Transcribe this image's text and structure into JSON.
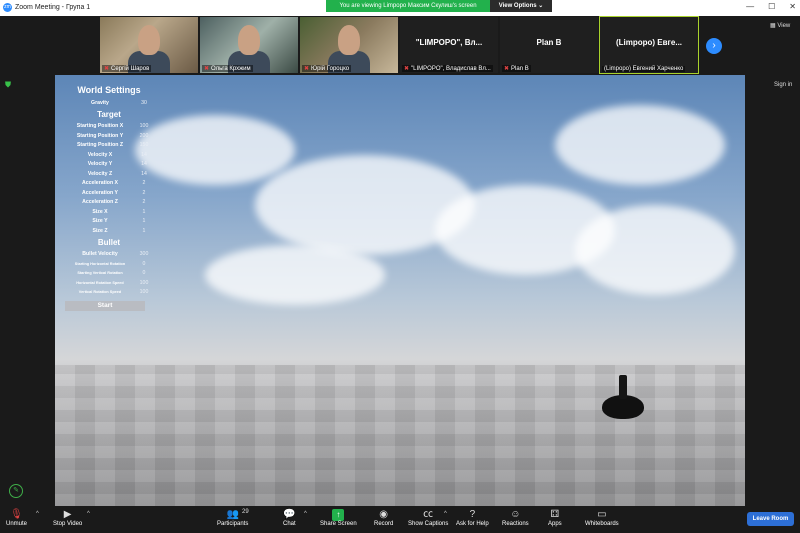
{
  "window": {
    "title": "Zoom Meeting - Група 1",
    "share_banner": "You are viewing Limpopo Максим Скулиш's screen",
    "view_options": "View Options"
  },
  "participants": [
    {
      "name": "Сергій Шаров"
    },
    {
      "name": "Ольга Крхжим"
    },
    {
      "name": "Юрій Гороцко"
    },
    {
      "name": "\"LIMPOPO\", Владислав Вл...",
      "display": "\"LIMPOPO\", Вл..."
    },
    {
      "name": "Plan B",
      "display": "Plan B"
    },
    {
      "name": "(Limpopo) Евгений Харченко",
      "display": "(Limpopo) Евге..."
    }
  ],
  "strip": {
    "view_label": "View"
  },
  "side": {
    "sign_in": "Sign in"
  },
  "settings": {
    "world_heading": "World Settings",
    "world": [
      {
        "label": "Gravity",
        "value": "30"
      }
    ],
    "target_heading": "Target",
    "target": [
      {
        "label": "Starting Position X",
        "value": "100"
      },
      {
        "label": "Starting Position Y",
        "value": "200"
      },
      {
        "label": "Starting Position Z",
        "value": "150"
      },
      {
        "label": "Velocity X",
        "value": "14"
      },
      {
        "label": "Velocity Y",
        "value": "14"
      },
      {
        "label": "Velocity Z",
        "value": "14"
      },
      {
        "label": "Acceleration X",
        "value": "2"
      },
      {
        "label": "Acceleration Y",
        "value": "2"
      },
      {
        "label": "Acceleration Z",
        "value": "2"
      },
      {
        "label": "Size X",
        "value": "1"
      },
      {
        "label": "Size Y",
        "value": "1"
      },
      {
        "label": "Size Z",
        "value": "1"
      }
    ],
    "bullet_heading": "Bullet",
    "bullet": [
      {
        "label": "Bullet Velocity",
        "value": "300"
      },
      {
        "label": "Starting Horizontal Rotation",
        "value": "0"
      },
      {
        "label": "Starting Vertical Rotation",
        "value": "0"
      },
      {
        "label": "Horizontal Rotation Speed",
        "value": "100"
      },
      {
        "label": "Vertical Rotation Speed",
        "value": "100"
      }
    ],
    "start_label": "Start"
  },
  "toolbar": {
    "unmute": "Unmute",
    "stop_video": "Stop Video",
    "participants": "Participants",
    "participants_count": "29",
    "chat": "Chat",
    "share_screen": "Share Screen",
    "record": "Record",
    "show_captions": "Show Captions",
    "ask_for_help": "Ask for Help",
    "reactions": "Reactions",
    "apps": "Apps",
    "whiteboards": "Whiteboards",
    "leave": "Leave Room"
  }
}
